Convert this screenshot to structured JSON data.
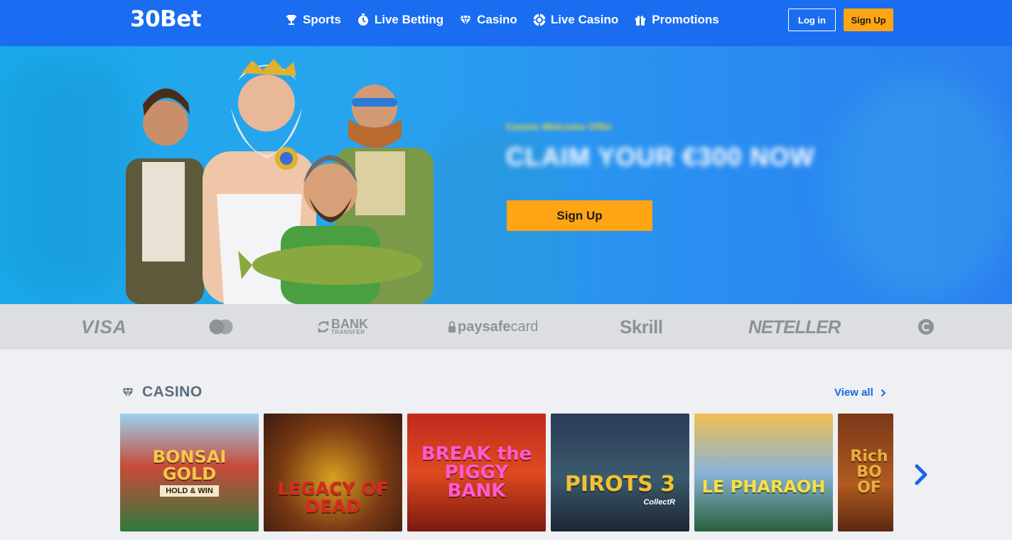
{
  "header": {
    "logo": "30Bet",
    "nav": [
      {
        "label": "Sports",
        "icon": "trophy-icon"
      },
      {
        "label": "Live Betting",
        "icon": "stopwatch-icon"
      },
      {
        "label": "Casino",
        "icon": "diamond-icon"
      },
      {
        "label": "Live Casino",
        "icon": "chip-icon"
      },
      {
        "label": "Promotions",
        "icon": "gift-icon"
      }
    ],
    "login_label": "Log in",
    "signup_label": "Sign Up"
  },
  "hero": {
    "subtitle": "Casino Welcome Offer",
    "title": "CLAIM YOUR €300 NOW",
    "cta_label": "Sign Up"
  },
  "payments": {
    "visa": "VISA",
    "bank": "BANK",
    "bank_sub": "TRANSFER",
    "paysafe_a": "paysafe",
    "paysafe_b": "card",
    "skrill": "Skrill",
    "neteller": "NETELLER"
  },
  "casino": {
    "title": "CASINO",
    "view_all": "View all",
    "games": [
      {
        "title": "BONSAI GOLD",
        "sub": "HOLD & WIN"
      },
      {
        "title": "LEGACY OF DEAD",
        "sub": ""
      },
      {
        "title": "BREAK the PIGGY BANK",
        "sub": ""
      },
      {
        "title": "PIROTS 3",
        "sub": "CollectR"
      },
      {
        "title": "LE PHARAOH",
        "sub": ""
      },
      {
        "title": "Rich BO OF",
        "sub": ""
      }
    ]
  },
  "colors": {
    "header_blue": "#1a6cf0",
    "accent_orange": "#ffa514",
    "link_blue": "#1767e0"
  }
}
